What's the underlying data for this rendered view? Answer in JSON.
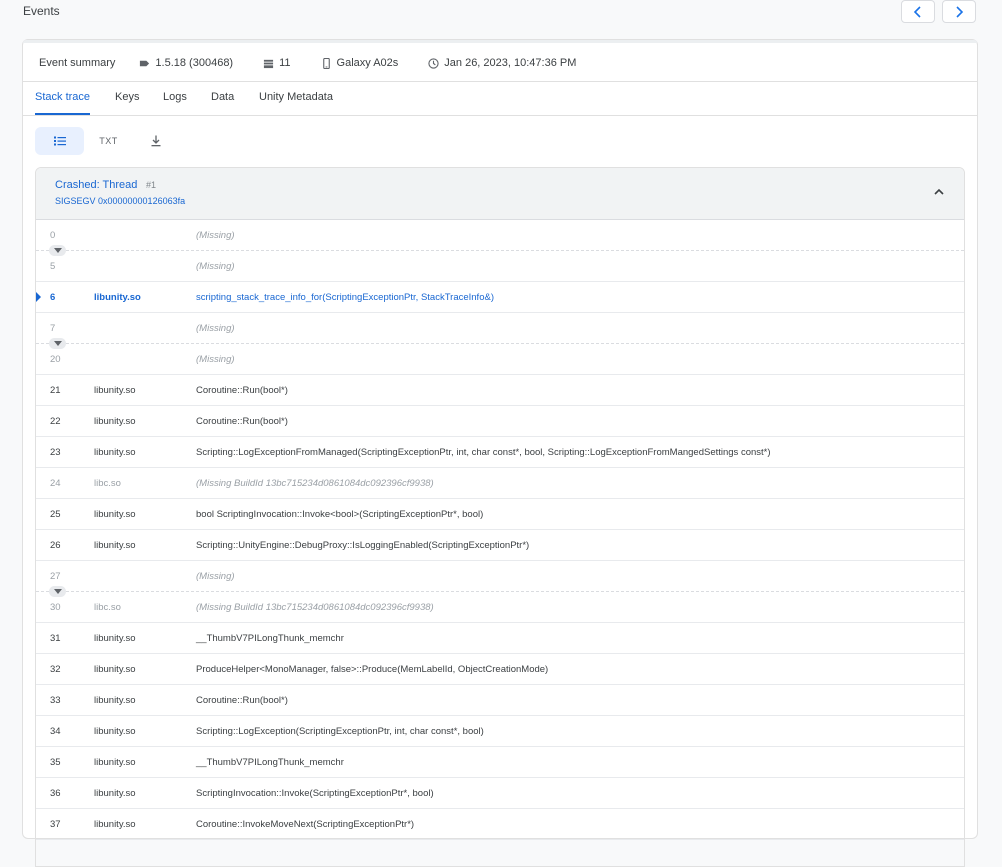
{
  "header": {
    "title": "Events"
  },
  "summary": {
    "label": "Event summary",
    "version": "1.5.18 (300468)",
    "count": "11",
    "device": "Galaxy A02s",
    "datetime": "Jan 26, 2023, 10:47:36 PM"
  },
  "tabs": [
    "Stack trace",
    "Keys",
    "Logs",
    "Data",
    "Unity Metadata"
  ],
  "view": {
    "txt_label": "TXT"
  },
  "trace": {
    "thread": "Crashed: Thread",
    "thread_number": "#1",
    "signal": "SIGSEGV 0x00000000126063fa",
    "frames": [
      {
        "n": "0",
        "lib": "",
        "sym": "(Missing)"
      },
      {
        "n": "5",
        "lib": "",
        "sym": "(Missing)"
      },
      {
        "n": "6",
        "lib": "libunity.so",
        "sym": "scripting_stack_trace_info_for(ScriptingExceptionPtr, StackTraceInfo&)"
      },
      {
        "n": "7",
        "lib": "",
        "sym": "(Missing)"
      },
      {
        "n": "20",
        "lib": "",
        "sym": "(Missing)"
      },
      {
        "n": "21",
        "lib": "libunity.so",
        "sym": "Coroutine::Run(bool*)"
      },
      {
        "n": "22",
        "lib": "libunity.so",
        "sym": "Coroutine::Run(bool*)"
      },
      {
        "n": "23",
        "lib": "libunity.so",
        "sym": "Scripting::LogExceptionFromManaged(ScriptingExceptionPtr, int, char const*, bool, Scripting::LogExceptionFromMangedSettings const*)"
      },
      {
        "n": "24",
        "lib": "libc.so",
        "sym": "(Missing BuildId 13bc715234d0861084dc092396cf9938)"
      },
      {
        "n": "25",
        "lib": "libunity.so",
        "sym": "bool ScriptingInvocation::Invoke<bool>(ScriptingExceptionPtr*, bool)"
      },
      {
        "n": "26",
        "lib": "libunity.so",
        "sym": "Scripting::UnityEngine::DebugProxy::IsLoggingEnabled(ScriptingExceptionPtr*)"
      },
      {
        "n": "27",
        "lib": "",
        "sym": "(Missing)"
      },
      {
        "n": "30",
        "lib": "libc.so",
        "sym": "(Missing BuildId 13bc715234d0861084dc092396cf9938)"
      },
      {
        "n": "31",
        "lib": "libunity.so",
        "sym": "__ThumbV7PILongThunk_memchr"
      },
      {
        "n": "32",
        "lib": "libunity.so",
        "sym": "ProduceHelper<MonoManager, false>::Produce(MemLabelId, ObjectCreationMode)"
      },
      {
        "n": "33",
        "lib": "libunity.so",
        "sym": "Coroutine::Run(bool*)"
      },
      {
        "n": "34",
        "lib": "libunity.so",
        "sym": "Scripting::LogException(ScriptingExceptionPtr, int, char const*, bool)"
      },
      {
        "n": "35",
        "lib": "libunity.so",
        "sym": "__ThumbV7PILongThunk_memchr"
      },
      {
        "n": "36",
        "lib": "libunity.so",
        "sym": "ScriptingInvocation::Invoke(ScriptingExceptionPtr*, bool)"
      },
      {
        "n": "37",
        "lib": "libunity.so",
        "sym": "Coroutine::InvokeMoveNext(ScriptingExceptionPtr*)"
      }
    ]
  }
}
